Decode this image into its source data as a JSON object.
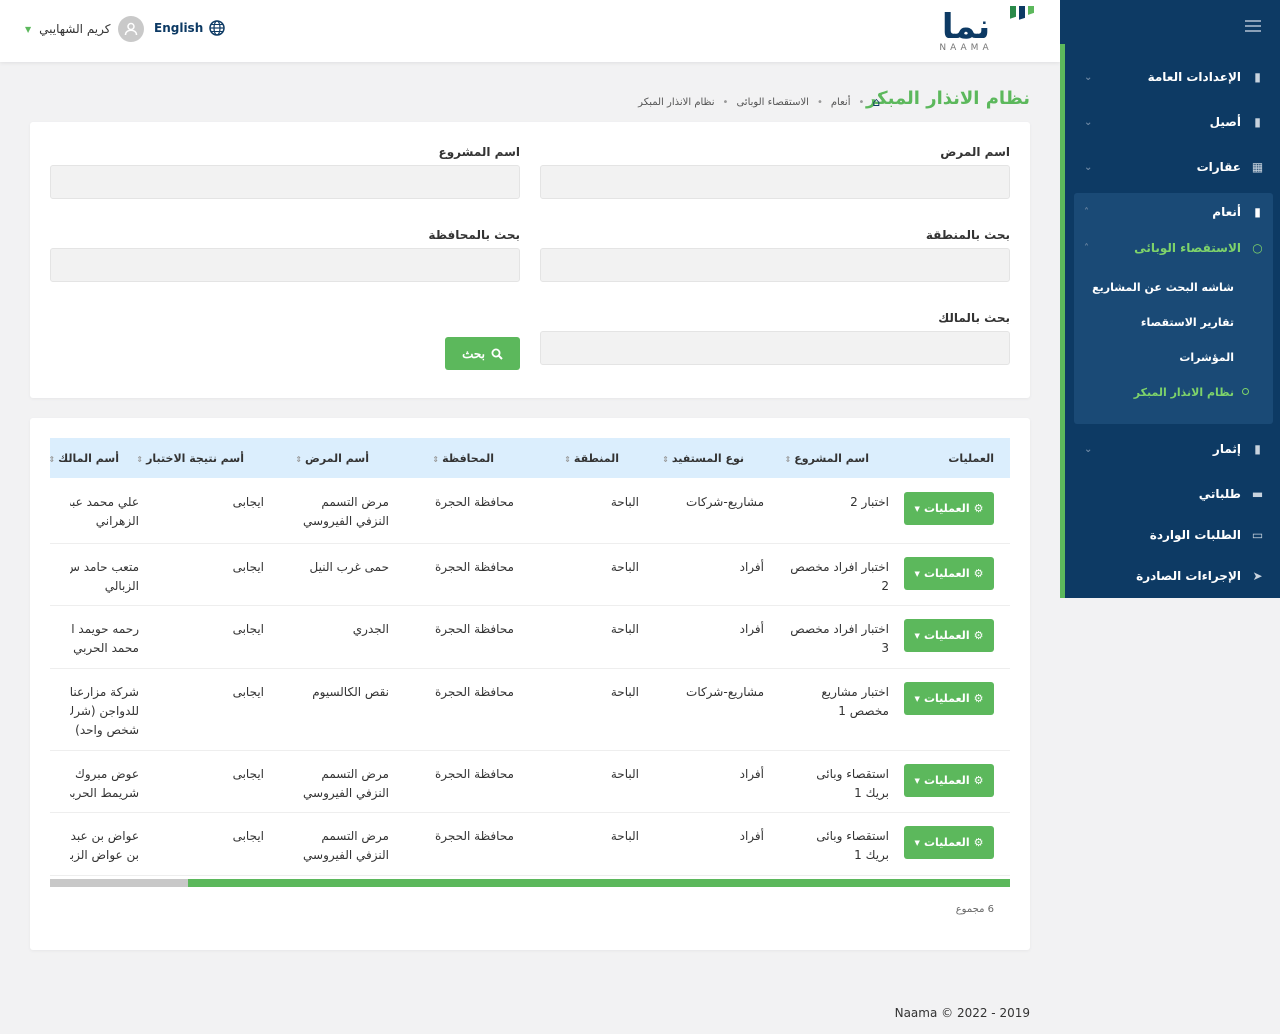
{
  "header": {
    "logo_ar": "نما",
    "logo_en": "NAAMA",
    "language": "English",
    "user_name": "كريم الشهايبي"
  },
  "colors": {
    "brand_navy": "#0d3a64",
    "brand_green": "#5cb85c",
    "table_header": "#dbeefd"
  },
  "sidebar": {
    "items": [
      {
        "label": "الإعدادات العامة",
        "icon": "book-icon"
      },
      {
        "label": "أصيل",
        "icon": "book-icon"
      },
      {
        "label": "عقارات",
        "icon": "building-icon"
      },
      {
        "label": "أنعام",
        "icon": "book-icon"
      },
      {
        "label": "إثمار",
        "icon": "book-icon"
      },
      {
        "label": "طلباتي",
        "icon": "folder-icon"
      },
      {
        "label": "الطلبات الواردة",
        "icon": "inbox-icon"
      },
      {
        "label": "الإجراءات الصادرة",
        "icon": "send-icon"
      }
    ],
    "group_title": "الاستقصاء الوبائى",
    "sub_items": [
      {
        "label": "شاشه البحث عن المشاريع"
      },
      {
        "label": "تقارير الاستقصاء"
      },
      {
        "label": "المؤشرات"
      },
      {
        "label": "نظام الانذار المبكر"
      }
    ]
  },
  "page": {
    "title": "نظام الانذار المبكر",
    "breadcrumb": [
      "أنعام",
      "الاستقصاء الوبائى",
      "نظام الانذار المبكر"
    ]
  },
  "search": {
    "disease_label": "اسم المرض",
    "project_label": "اسم المشروع",
    "region_label": "بحث بالمنطقة",
    "governorate_label": "بحث بالمحافظة",
    "owner_label": "بحث بالمالك",
    "button_label": "بحث"
  },
  "table": {
    "columns": [
      "العمليات",
      "اسم المشروع",
      "نوع المستفيد",
      "المنطقة",
      "المحافظة",
      "أسم المرض",
      "أسم نتيجة الاختبار",
      "أسم المالك"
    ],
    "ops_label": "العمليات",
    "rows": [
      {
        "project": [
          "اختبار 2"
        ],
        "beneficiary": "مشاريع-شركات",
        "region": "الباحة",
        "governorate": "محافظة الحجرة",
        "disease": [
          "مرض التسمم",
          "النزفي الفيروسي"
        ],
        "result": "ايجابى",
        "owner": [
          "علي محمد عبد",
          "الزهراني"
        ]
      },
      {
        "project": [
          "اختبار افراد مخصص",
          "2"
        ],
        "beneficiary": "أفراد",
        "region": "الباحة",
        "governorate": "محافظة الحجرة",
        "disease": [
          "حمى غرب النيل"
        ],
        "result": "ايجابى",
        "owner": [
          "متعب حامد س",
          "الزبالي"
        ]
      },
      {
        "project": [
          "اختبار افراد مخصص",
          "3"
        ],
        "beneficiary": "أفراد",
        "region": "الباحة",
        "governorate": "محافظة الحجرة",
        "disease": [
          "الجدري"
        ],
        "result": "ايجابى",
        "owner": [
          "رحمه حويمد ا",
          "محمد الحربي"
        ]
      },
      {
        "project": [
          "اختبار مشاريع",
          "مخصص 1"
        ],
        "beneficiary": "مشاريع-شركات",
        "region": "الباحة",
        "governorate": "محافظة الحجرة",
        "disease": [
          "نقص الكالسيوم"
        ],
        "result": "ايجابى",
        "owner": [
          "شركة مزارعنا",
          "للدواجن (شرك",
          "شخص واحد)"
        ]
      },
      {
        "project": [
          "استقصاء وبائى",
          "بريك 1"
        ],
        "beneficiary": "أفراد",
        "region": "الباحة",
        "governorate": "محافظة الحجرة",
        "disease": [
          "مرض التسمم",
          "النزفي الفيروسي"
        ],
        "result": "ايجابى",
        "owner": [
          "عوض مبروك",
          "شريمط الحربي"
        ]
      },
      {
        "project": [
          "استقصاء وبائى",
          "بريك 1"
        ],
        "beneficiary": "أفراد",
        "region": "الباحة",
        "governorate": "محافظة الحجرة",
        "disease": [
          "مرض التسمم",
          "النزفي الفيروسي"
        ],
        "result": "ايجابى",
        "owner": [
          "عواض بن عبدا",
          "بن عواض الزبال"
        ]
      }
    ],
    "total": "6 مجموع"
  },
  "footer": {
    "text": "Naama © 2022 - 2019"
  }
}
